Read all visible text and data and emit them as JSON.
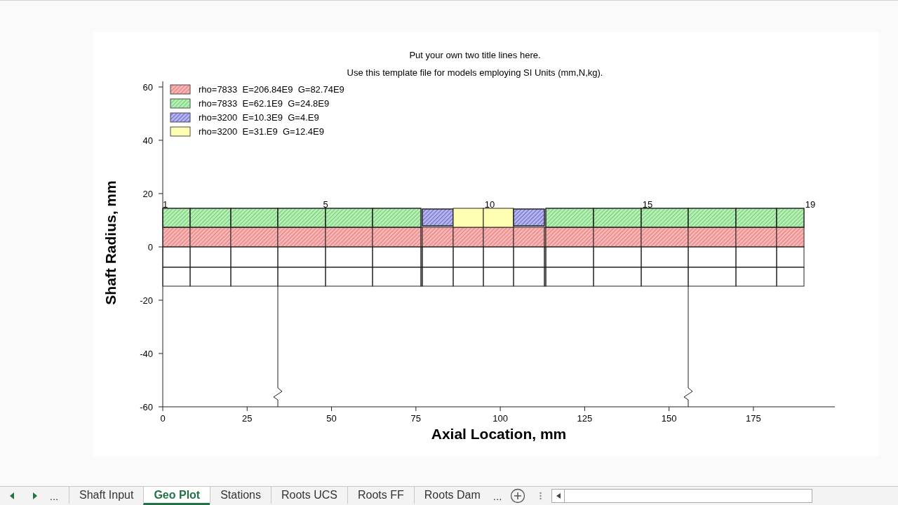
{
  "chart": {
    "title_lines": [
      "Put your own two title lines here.",
      "Use this template file for models employing SI Units (mm,N,kg)."
    ],
    "legend": [
      {
        "label": "rho=7833  E=206.84E9  G=82.74E9",
        "color": "#f6b4b4"
      },
      {
        "label": "rho=7833  E=62.1E9  G=24.8E9",
        "color": "#b4f0b4"
      },
      {
        "label": "rho=3200  E=10.3E9  G=4.E9",
        "color": "#b4b4f0"
      },
      {
        "label": "rho=3200  E=31.E9  G=12.4E9",
        "color": "#ffffb4"
      }
    ],
    "station_labels": [
      "1",
      "5",
      "10",
      "15",
      "19"
    ],
    "xlabel": "Axial Location, mm",
    "ylabel": "Shaft Radius, mm",
    "xticks": [
      "0",
      "25",
      "50",
      "75",
      "100",
      "125",
      "150",
      "175"
    ],
    "yticks": [
      "60",
      "40",
      "20",
      "0",
      "-20",
      "-40",
      "-60"
    ]
  },
  "sheet_nav": {
    "overflow": "..."
  },
  "sheet_tabs": [
    {
      "label": "Shaft Input",
      "selected": false
    },
    {
      "label": "Geo Plot",
      "selected": true
    },
    {
      "label": "Stations",
      "selected": false
    },
    {
      "label": "Roots UCS",
      "selected": false
    },
    {
      "label": "Roots FF",
      "selected": false
    },
    {
      "label": "Roots Dam",
      "selected": false
    }
  ],
  "more_tabs": "..."
}
